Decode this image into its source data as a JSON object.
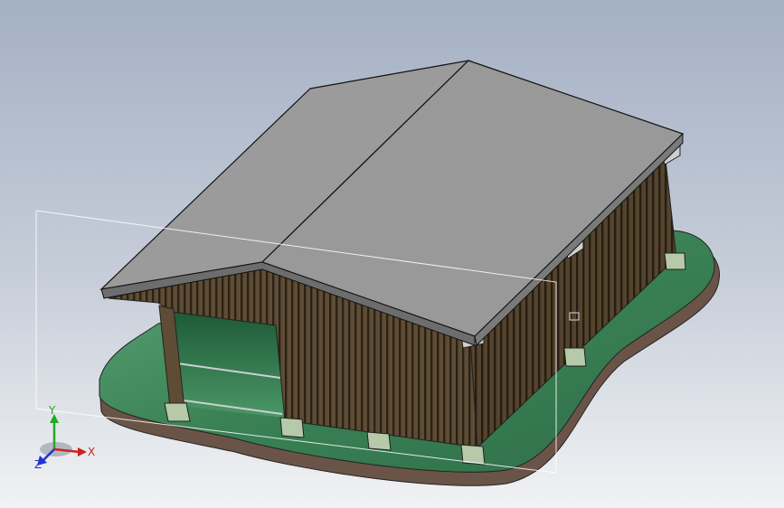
{
  "viewport": {
    "background_top": "#a4b0c4",
    "background_bottom": "#f1f2f4"
  },
  "model": {
    "description_icon": "barn-3d-model",
    "roof_color": "#999999",
    "wall_color": "#5a4a32",
    "wall_stripe_color": "#2b2116",
    "ground_top_color": "#3f8a5c",
    "ground_edge_color": "#6a5448",
    "footing_color": "#b6c9a8"
  },
  "triad": {
    "x_label": "X",
    "y_label": "Y",
    "z_label": "Z",
    "x_color": "#cc2222",
    "y_color": "#22aa22",
    "z_color": "#2233cc"
  }
}
